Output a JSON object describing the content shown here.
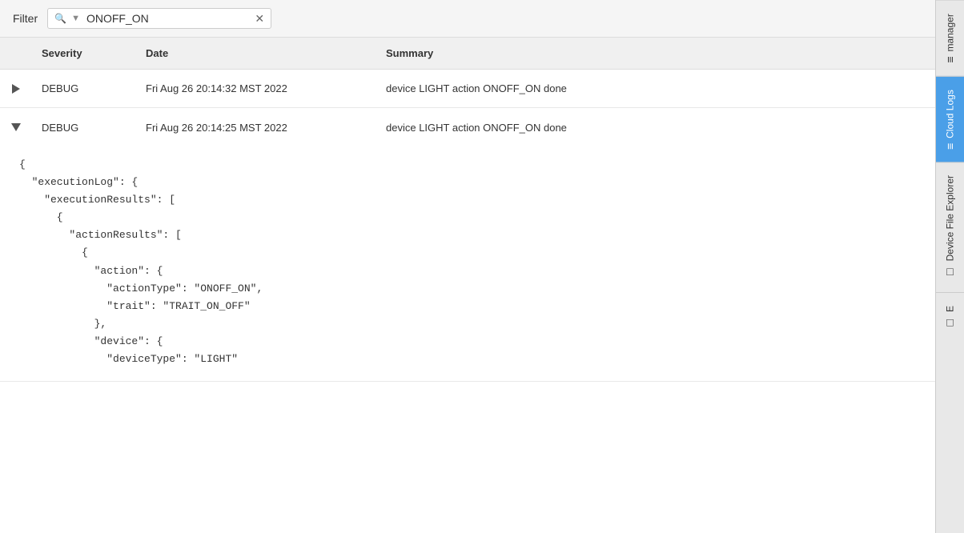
{
  "filter": {
    "label": "Filter",
    "value": "ONOFF_ON",
    "placeholder": "Filter...",
    "icon": "🔍"
  },
  "table": {
    "headers": [
      "",
      "Severity",
      "Date",
      "Summary"
    ],
    "rows": [
      {
        "id": "row-1",
        "expanded": false,
        "severity": "DEBUG",
        "date": "Fri Aug 26 20:14:32 MST 2022",
        "summary": "device LIGHT action ONOFF_ON done"
      },
      {
        "id": "row-2",
        "expanded": true,
        "severity": "DEBUG",
        "date": "Fri Aug 26 20:14:25 MST 2022",
        "summary": "device LIGHT action ONOFF_ON done"
      }
    ],
    "expandedContent": "{\n  \"executionLog\": {\n    \"executionResults\": [\n      {\n        \"actionResults\": [\n          {\n            \"action\": {\n              \"actionType\": \"ONOFF_ON\",\n              \"trait\": \"TRAIT_ON_OFF\"\n            },\n            \"device\": {\n              \"deviceType\": \"LIGHT\""
  },
  "sidebar": {
    "items": [
      {
        "label": "manager",
        "icon": "≡",
        "active": false
      },
      {
        "label": "Cloud Logs",
        "icon": "≡",
        "active": true
      },
      {
        "label": "Device File Explorer",
        "icon": "□",
        "active": false
      },
      {
        "label": "E",
        "icon": "□",
        "active": false
      }
    ]
  }
}
